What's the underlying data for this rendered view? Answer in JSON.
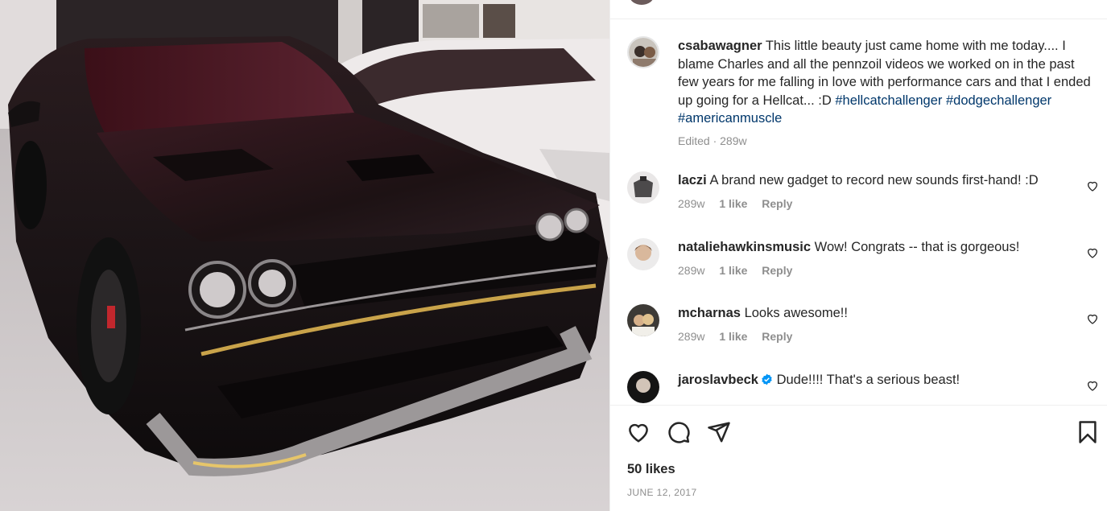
{
  "post": {
    "author": "csabawagner",
    "caption_text": " This little beauty just came home with me today.... I blame Charles and all the pennzoil videos we worked on in the past few years for me falling in love with performance cars and that I ended up going for a Hellcat... :D ",
    "hashtags": [
      "#hellcatchallenger",
      "#dodgechallenger",
      "#americanmuscle"
    ],
    "edited_label": "Edited · 289w",
    "likes": "50 likes",
    "date": "JUNE 12, 2017"
  },
  "comments": [
    {
      "user": "laczi",
      "text": "A brand new gadget to record new sounds first-hand! :D",
      "age": "289w",
      "likes": "1 like",
      "reply": "Reply",
      "verified": false
    },
    {
      "user": "nataliehawkinsmusic",
      "text": "Wow! Congrats -- that is gorgeous!",
      "age": "289w",
      "likes": "1 like",
      "reply": "Reply",
      "verified": false
    },
    {
      "user": "mcharnas",
      "text": "Looks awesome!!",
      "age": "289w",
      "likes": "1 like",
      "reply": "Reply",
      "verified": false
    },
    {
      "user": "jaroslavbeck",
      "text": "Dude!!!! That's a serious beast!",
      "verified": true
    }
  ],
  "icons": {
    "like": "heart-outline-icon",
    "comment": "comment-bubble-icon",
    "share": "paper-plane-icon",
    "save": "bookmark-icon",
    "comment_like": "heart-small-icon",
    "verified": "verified-badge-icon"
  },
  "colors": {
    "hashtag": "#00376b",
    "muted": "#8e8e8e",
    "verified": "#0095f6",
    "text": "#262626"
  }
}
